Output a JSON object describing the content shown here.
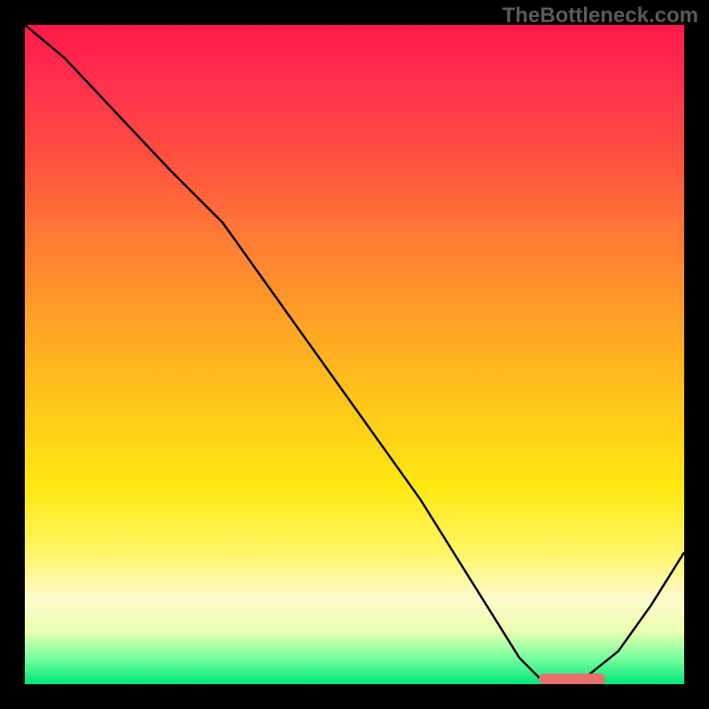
{
  "watermark": "TheBottleneck.com",
  "chart_data": {
    "type": "line",
    "title": "",
    "xlabel": "",
    "ylabel": "",
    "x_range": [
      0,
      100
    ],
    "y_range": [
      0,
      100
    ],
    "curve": {
      "x": [
        0,
        6,
        22,
        30,
        40,
        50,
        60,
        70,
        75,
        78,
        85,
        90,
        95,
        100
      ],
      "y": [
        100,
        95,
        78,
        70,
        56,
        42,
        28,
        12,
        4,
        1,
        1,
        5,
        12,
        20
      ]
    },
    "optimum_band": {
      "x_start": 78,
      "x_end": 88,
      "y": 0.8
    },
    "background_gradient": {
      "top_color": "#ff1a4a",
      "mid_color": "#ffd000",
      "bottom_color": "#00e67a"
    }
  }
}
